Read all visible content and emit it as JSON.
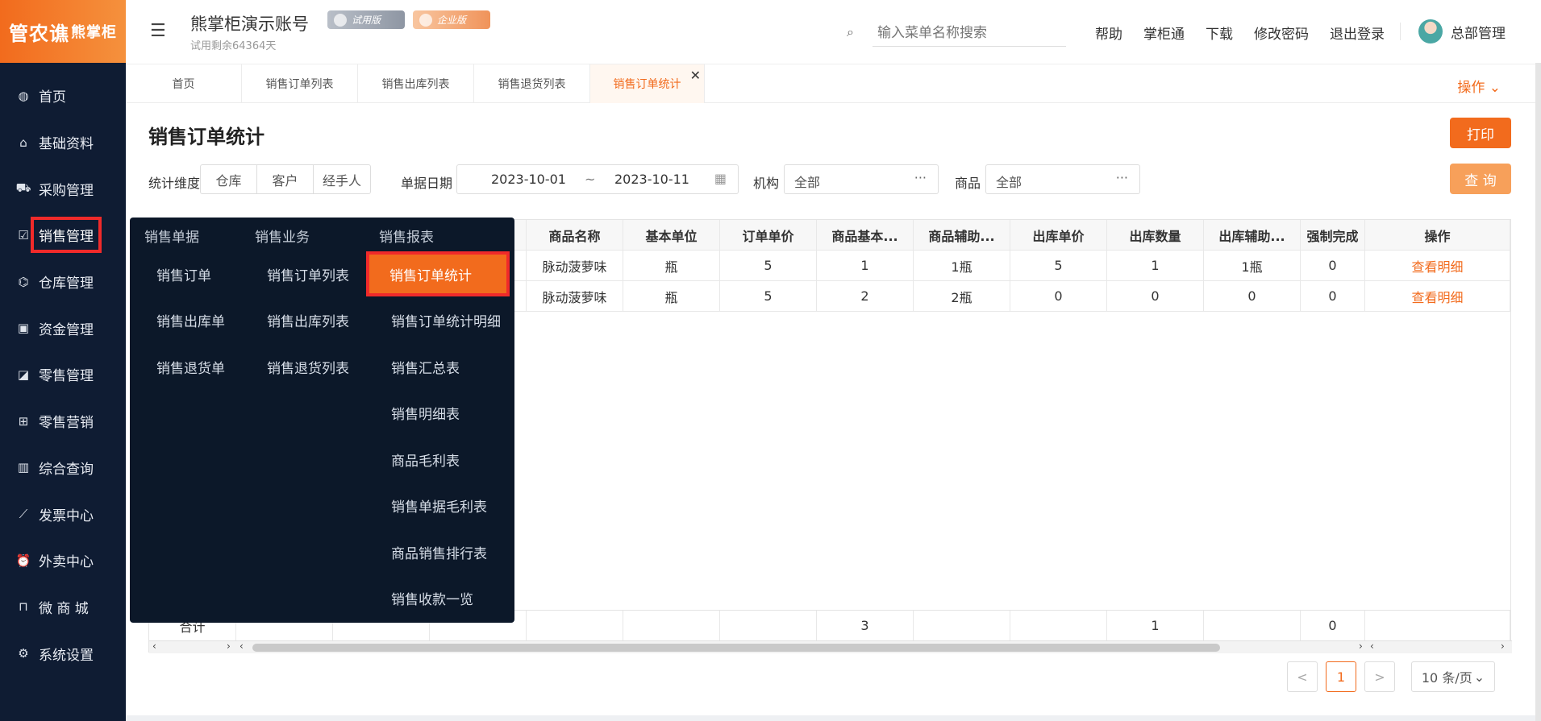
{
  "sidebar": {
    "logo_main": "管农谯",
    "logo_sub": "熊掌柜",
    "items": [
      {
        "label": "首页",
        "icon": "globe-icon"
      },
      {
        "label": "基础资料",
        "icon": "home-icon"
      },
      {
        "label": "采购管理",
        "icon": "cart-icon"
      },
      {
        "label": "销售管理",
        "icon": "sales-icon"
      },
      {
        "label": "仓库管理",
        "icon": "bank-icon"
      },
      {
        "label": "资金管理",
        "icon": "calendar-icon"
      },
      {
        "label": "零售管理",
        "icon": "area-chart-icon"
      },
      {
        "label": "零售营销",
        "icon": "gift-icon"
      },
      {
        "label": "综合查询",
        "icon": "bar-chart-icon"
      },
      {
        "label": "发票中心",
        "icon": "line-chart-icon"
      },
      {
        "label": "外卖中心",
        "icon": "alarm-icon"
      },
      {
        "label": "微 商 城",
        "icon": "shopping-bag-icon"
      },
      {
        "label": "系统设置",
        "icon": "gear-icon"
      }
    ]
  },
  "header": {
    "account_title": "熊掌柜演示账号",
    "trial_badge": "试用版",
    "enterprise_badge": "企业版",
    "trial_remaining": "试用剩余64364天",
    "search_placeholder": "输入菜单名称搜索",
    "links": [
      "帮助",
      "掌柜通",
      "下载",
      "修改密码",
      "退出登录"
    ],
    "user_name": "总部管理"
  },
  "tabs": {
    "items": [
      "首页",
      "销售订单列表",
      "销售出库列表",
      "销售退货列表",
      "销售订单统计"
    ],
    "operations": "操作"
  },
  "page": {
    "title": "销售订单统计",
    "print": "打印",
    "query": "查 询",
    "stat_dim_label": "统计维度",
    "stat_dims": [
      "仓库",
      "客户",
      "经手人"
    ],
    "date_label": "单据日期",
    "date_from": "2023-10-01",
    "date_sep": "~",
    "date_to": "2023-10-11",
    "org_label": "机构",
    "org_value": "全部",
    "product_label": "商品",
    "product_value": "全部",
    "more": "···"
  },
  "table": {
    "columns": [
      "商品名称",
      "基本单位",
      "订单单价",
      "商品基本...",
      "商品辅助...",
      "出库单价",
      "出库数量",
      "出库辅助...",
      "强制完成",
      "操作"
    ],
    "rows": [
      [
        "脉动菠萝味",
        "瓶",
        "5",
        "1",
        "1瓶",
        "5",
        "1",
        "1瓶",
        "0",
        "查看明细"
      ],
      [
        "脉动菠萝味",
        "瓶",
        "5",
        "2",
        "2瓶",
        "0",
        "0",
        "0",
        "0",
        "查看明细"
      ]
    ],
    "totals_label": "合计",
    "totals": [
      "",
      "",
      "",
      "3",
      "",
      "",
      "1",
      "",
      "0",
      ""
    ]
  },
  "pagination": {
    "prev": "<",
    "current": "1",
    "next": ">",
    "page_size": "10 条/页"
  },
  "flyout": {
    "col1_header": "销售单据",
    "col2_header": "销售业务",
    "col3_header": "销售报表",
    "col1": [
      "销售订单",
      "销售出库单",
      "销售退货单"
    ],
    "col2": [
      "销售订单列表",
      "销售出库列表",
      "销售退货列表"
    ],
    "col3": [
      "销售订单统计",
      "销售订单统计明细",
      "销售汇总表",
      "销售明细表",
      "商品毛利表",
      "销售单据毛利表",
      "商品销售排行表",
      "销售收款一览"
    ]
  }
}
